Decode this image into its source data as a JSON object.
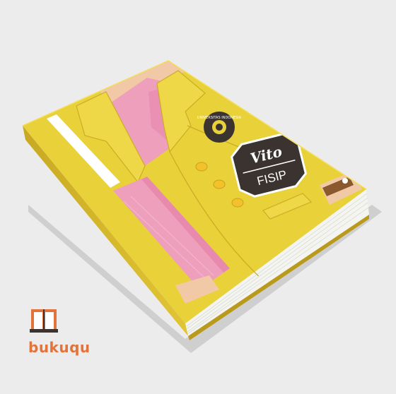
{
  "badge": {
    "name": "Vito",
    "faculty": "FISIP",
    "name_color": "#ffffff"
  },
  "emblem": {
    "university_text": "UNIVERSITAS INDONESIA"
  },
  "brand": {
    "name": "bukuqu",
    "color": "#e2733a"
  },
  "colors": {
    "jacket": "#e9d13a",
    "jacket_shade": "#d9bd2b",
    "shirt": "#ee9fbc",
    "skin": "#f1c9a6",
    "badge": "#3a3330",
    "stripe": "#ffffff",
    "background": "#ececec"
  }
}
